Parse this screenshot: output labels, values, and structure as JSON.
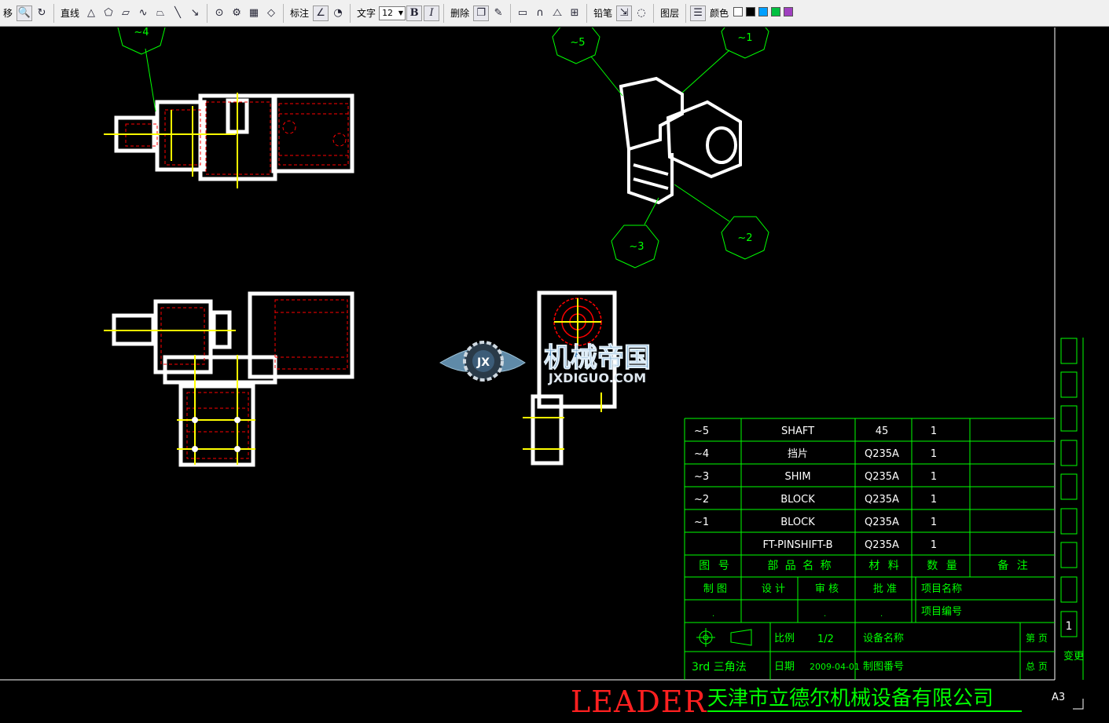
{
  "toolbar": {
    "move_label": "移",
    "line_label": "直线",
    "dim_label": "标注",
    "text_label": "文字",
    "font_size": "12",
    "bold_label": "B",
    "italic_label": "I",
    "delete_label": "删除",
    "pencil_label": "铅笔",
    "layer_label": "图层",
    "color_label": "颜色",
    "swatches": [
      "#ffffff",
      "#000000",
      "#00a0ff",
      "#00c040",
      "#a040c0"
    ]
  },
  "balloons": {
    "b5": "~5",
    "b1": "~1",
    "b3": "~3",
    "b2": "~2",
    "b4": "~4"
  },
  "watermark": {
    "logo_text": "JX",
    "title": "机械帝国",
    "url": "JXDIGUO.COM"
  },
  "bom": [
    {
      "no": "~5",
      "name": "SHAFT",
      "material": "45",
      "qty": "1",
      "note": ""
    },
    {
      "no": "~4",
      "name": "挡片",
      "material": "Q235A",
      "qty": "1",
      "note": ""
    },
    {
      "no": "~3",
      "name": "SHIM",
      "material": "Q235A",
      "qty": "1",
      "note": ""
    },
    {
      "no": "~2",
      "name": "BLOCK",
      "material": "Q235A",
      "qty": "1",
      "note": ""
    },
    {
      "no": "~1",
      "name": "BLOCK",
      "material": "Q235A",
      "qty": "1",
      "note": ""
    },
    {
      "no": "",
      "name": "FT-PINSHIFT-B",
      "material": "Q235A",
      "qty": "1",
      "note": ""
    }
  ],
  "bom_header": {
    "no": "图 号",
    "name": "部 品 名 称",
    "material": "材 料",
    "qty": "数 量",
    "note": "备 注"
  },
  "title_block": {
    "draw": "制 图",
    "design": "设 计",
    "check": "审 核",
    "approve": "批 准",
    "project_name": "项目名称",
    "project_no": "项目编号",
    "scale_label": "比例",
    "scale_value": "1/2",
    "equipment_name": "设备名称",
    "page_label": "第 页",
    "method": "3rd 三角法",
    "date_label": "日期",
    "date_value": "2009-04-01",
    "drawing_no": "制图番号",
    "total_label": "总 页",
    "dot": "."
  },
  "revision": {
    "number": "1",
    "label": "变更"
  },
  "company": {
    "brand": "LEADER",
    "name": "天津市立德尔机械设备有限公司",
    "sheet": "A3"
  },
  "colors": {
    "frame": "#00ff00",
    "drawing": "#ffffff",
    "hidden": "#ff0000",
    "center": "#ffff00",
    "brand": "#ff2020"
  }
}
